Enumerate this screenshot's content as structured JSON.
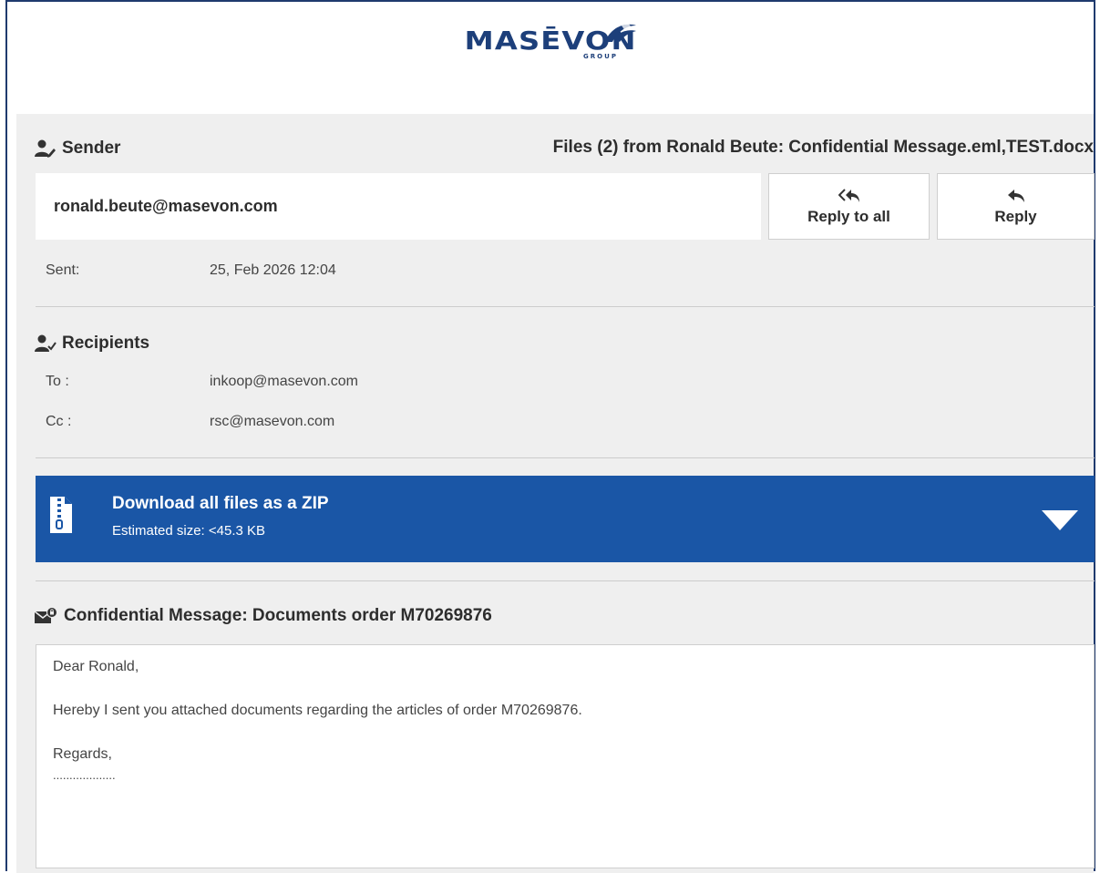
{
  "logo": {
    "name": "MASĒVON",
    "sub": "GROUP"
  },
  "sender": {
    "heading": "Sender",
    "email": "ronald.beute@masevon.com",
    "files_title": "Files (2) from Ronald Beute: Confidential Message.eml,TEST.docx"
  },
  "actions": {
    "reply_all": "Reply to all",
    "reply": "Reply"
  },
  "sent": {
    "label": "Sent:",
    "value": "25, Feb 2026 12:04"
  },
  "recipients": {
    "heading": "Recipients",
    "to_label": "To :",
    "to_value": "inkoop@masevon.com",
    "cc_label": "Cc :",
    "cc_value": "rsc@masevon.com"
  },
  "zip": {
    "title": "Download all files as a ZIP",
    "size": "Estimated size: <45.3 KB"
  },
  "message": {
    "subject": "Confidential Message: Documents order M70269876",
    "greeting": "Dear Ronald,",
    "body": "Hereby I sent you attached documents regarding the articles of order M70269876.",
    "closing": "Regards,",
    "signature": "..................."
  },
  "colors": {
    "brand": "#1d3f7a",
    "zip_bar": "#1a56a6",
    "panel": "#efefef"
  }
}
